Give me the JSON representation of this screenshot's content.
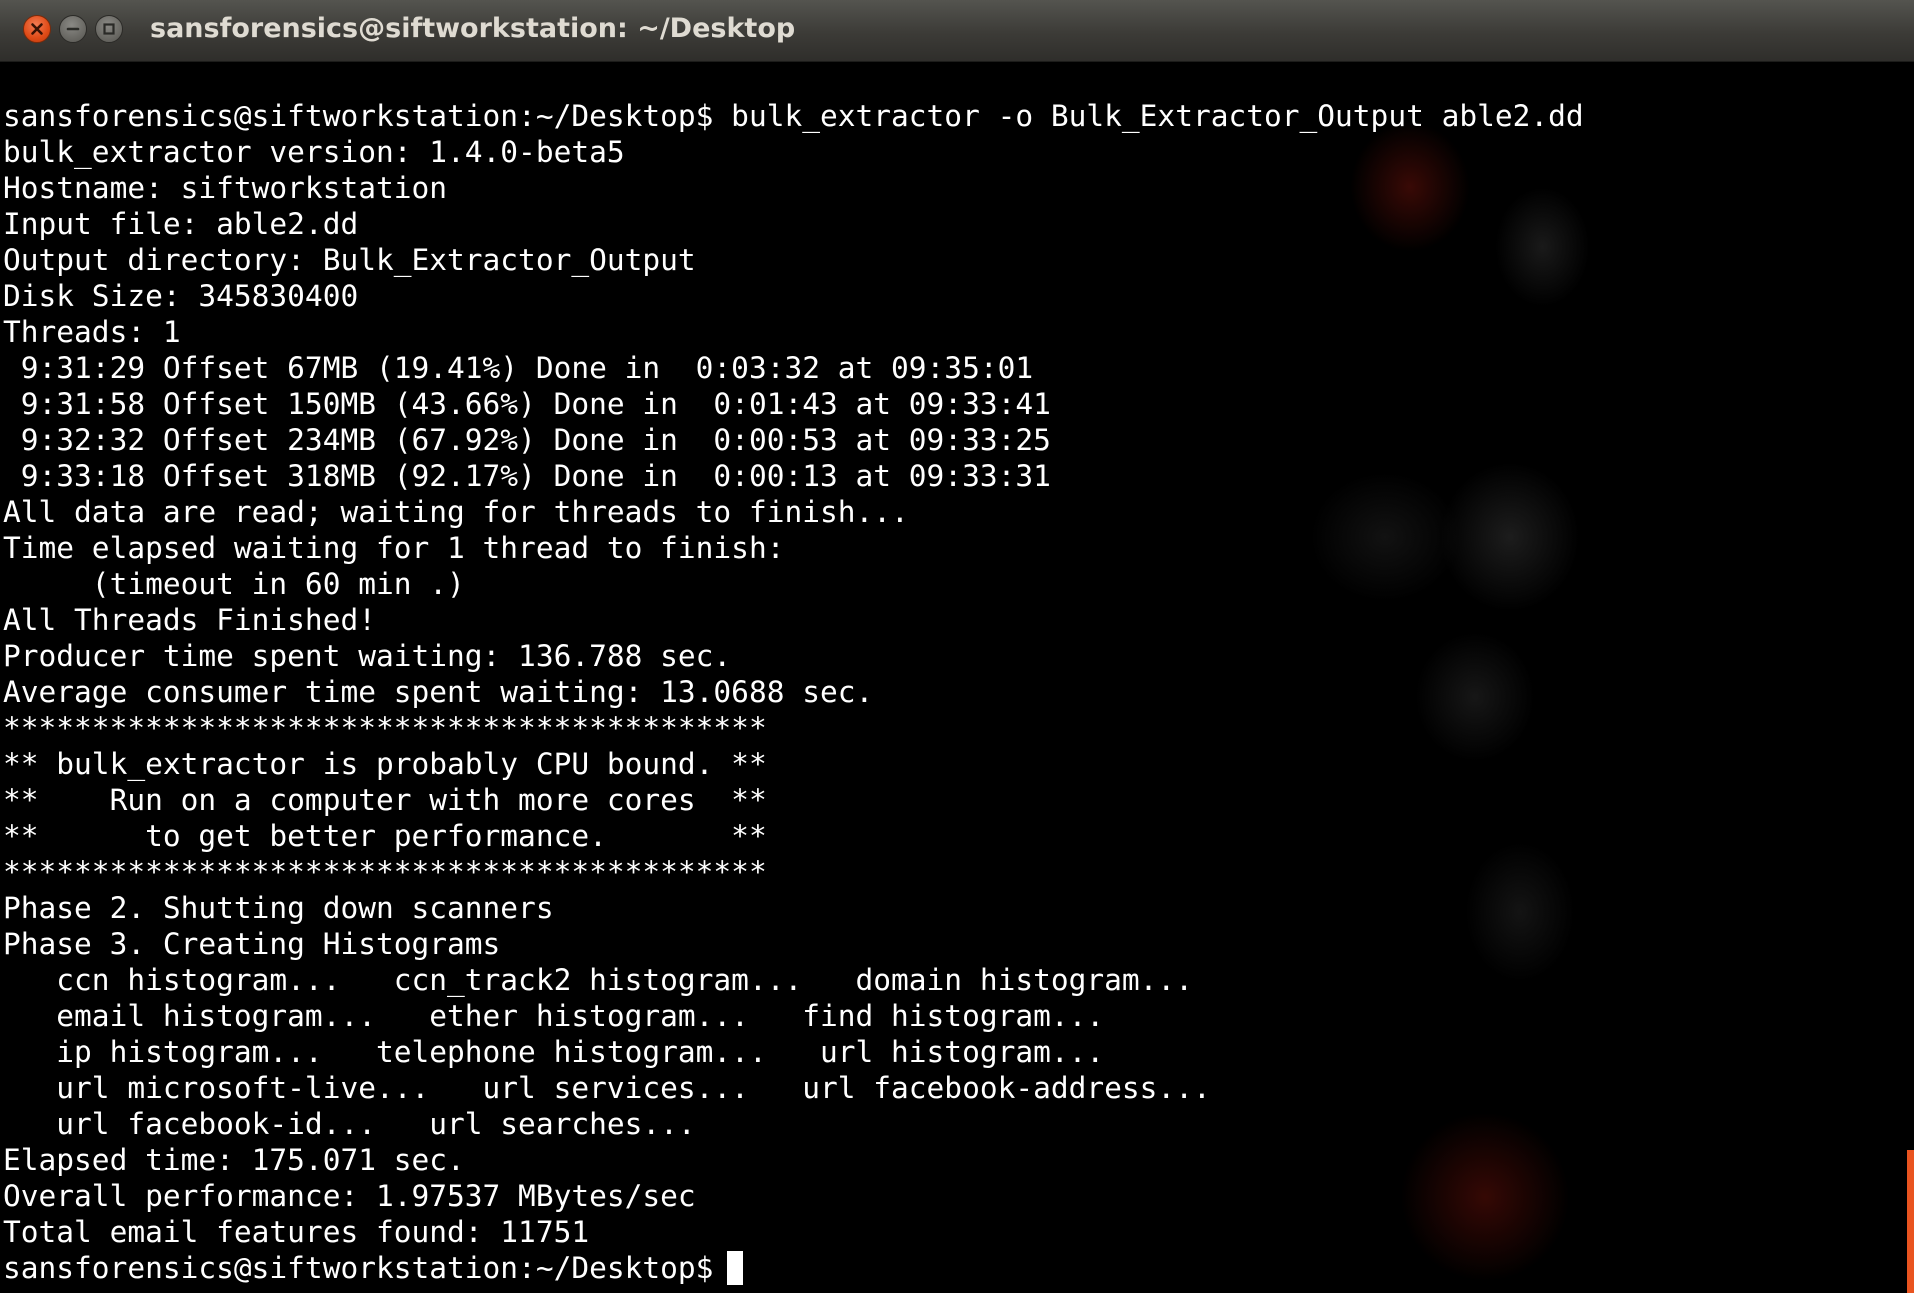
{
  "window": {
    "title": "sansforensics@siftworkstation: ~/Desktop"
  },
  "terminal": {
    "lines": [
      "sansforensics@siftworkstation:~/Desktop$ bulk_extractor -o Bulk_Extractor_Output able2.dd",
      "bulk_extractor version: 1.4.0-beta5",
      "Hostname: siftworkstation",
      "Input file: able2.dd",
      "Output directory: Bulk_Extractor_Output",
      "Disk Size: 345830400",
      "Threads: 1",
      " 9:31:29 Offset 67MB (19.41%) Done in  0:03:32 at 09:35:01",
      " 9:31:58 Offset 150MB (43.66%) Done in  0:01:43 at 09:33:41",
      " 9:32:32 Offset 234MB (67.92%) Done in  0:00:53 at 09:33:25",
      " 9:33:18 Offset 318MB (92.17%) Done in  0:00:13 at 09:33:31",
      "All data are read; waiting for threads to finish...",
      "Time elapsed waiting for 1 thread to finish:",
      "     (timeout in 60 min .)",
      "All Threads Finished!",
      "Producer time spent waiting: 136.788 sec.",
      "Average consumer time spent waiting: 13.0688 sec.",
      "*******************************************",
      "** bulk_extractor is probably CPU bound. **",
      "**    Run on a computer with more cores  **",
      "**      to get better performance.       **",
      "*******************************************",
      "Phase 2. Shutting down scanners",
      "Phase 3. Creating Histograms",
      "   ccn histogram...   ccn_track2 histogram...   domain histogram...",
      "   email histogram...   ether histogram...   find histogram...",
      "   ip histogram...   telephone histogram...   url histogram...",
      "   url microsoft-live...   url services...   url facebook-address...",
      "   url facebook-id...   url searches...",
      "Elapsed time: 175.071 sec.",
      "Overall performance: 1.97537 MBytes/sec",
      "Total email features found: 11751"
    ],
    "prompt": "sansforensics@siftworkstation:~/Desktop$"
  },
  "icons": {
    "close": "close-icon",
    "minimize": "minimize-icon",
    "maximize": "maximize-icon"
  },
  "colors": {
    "terminal_bg": "#000000",
    "terminal_fg": "#ffffff",
    "titlebar_bg": "#3c3b37",
    "title_fg": "#dfdbd2",
    "close_button": "#df4a16"
  }
}
